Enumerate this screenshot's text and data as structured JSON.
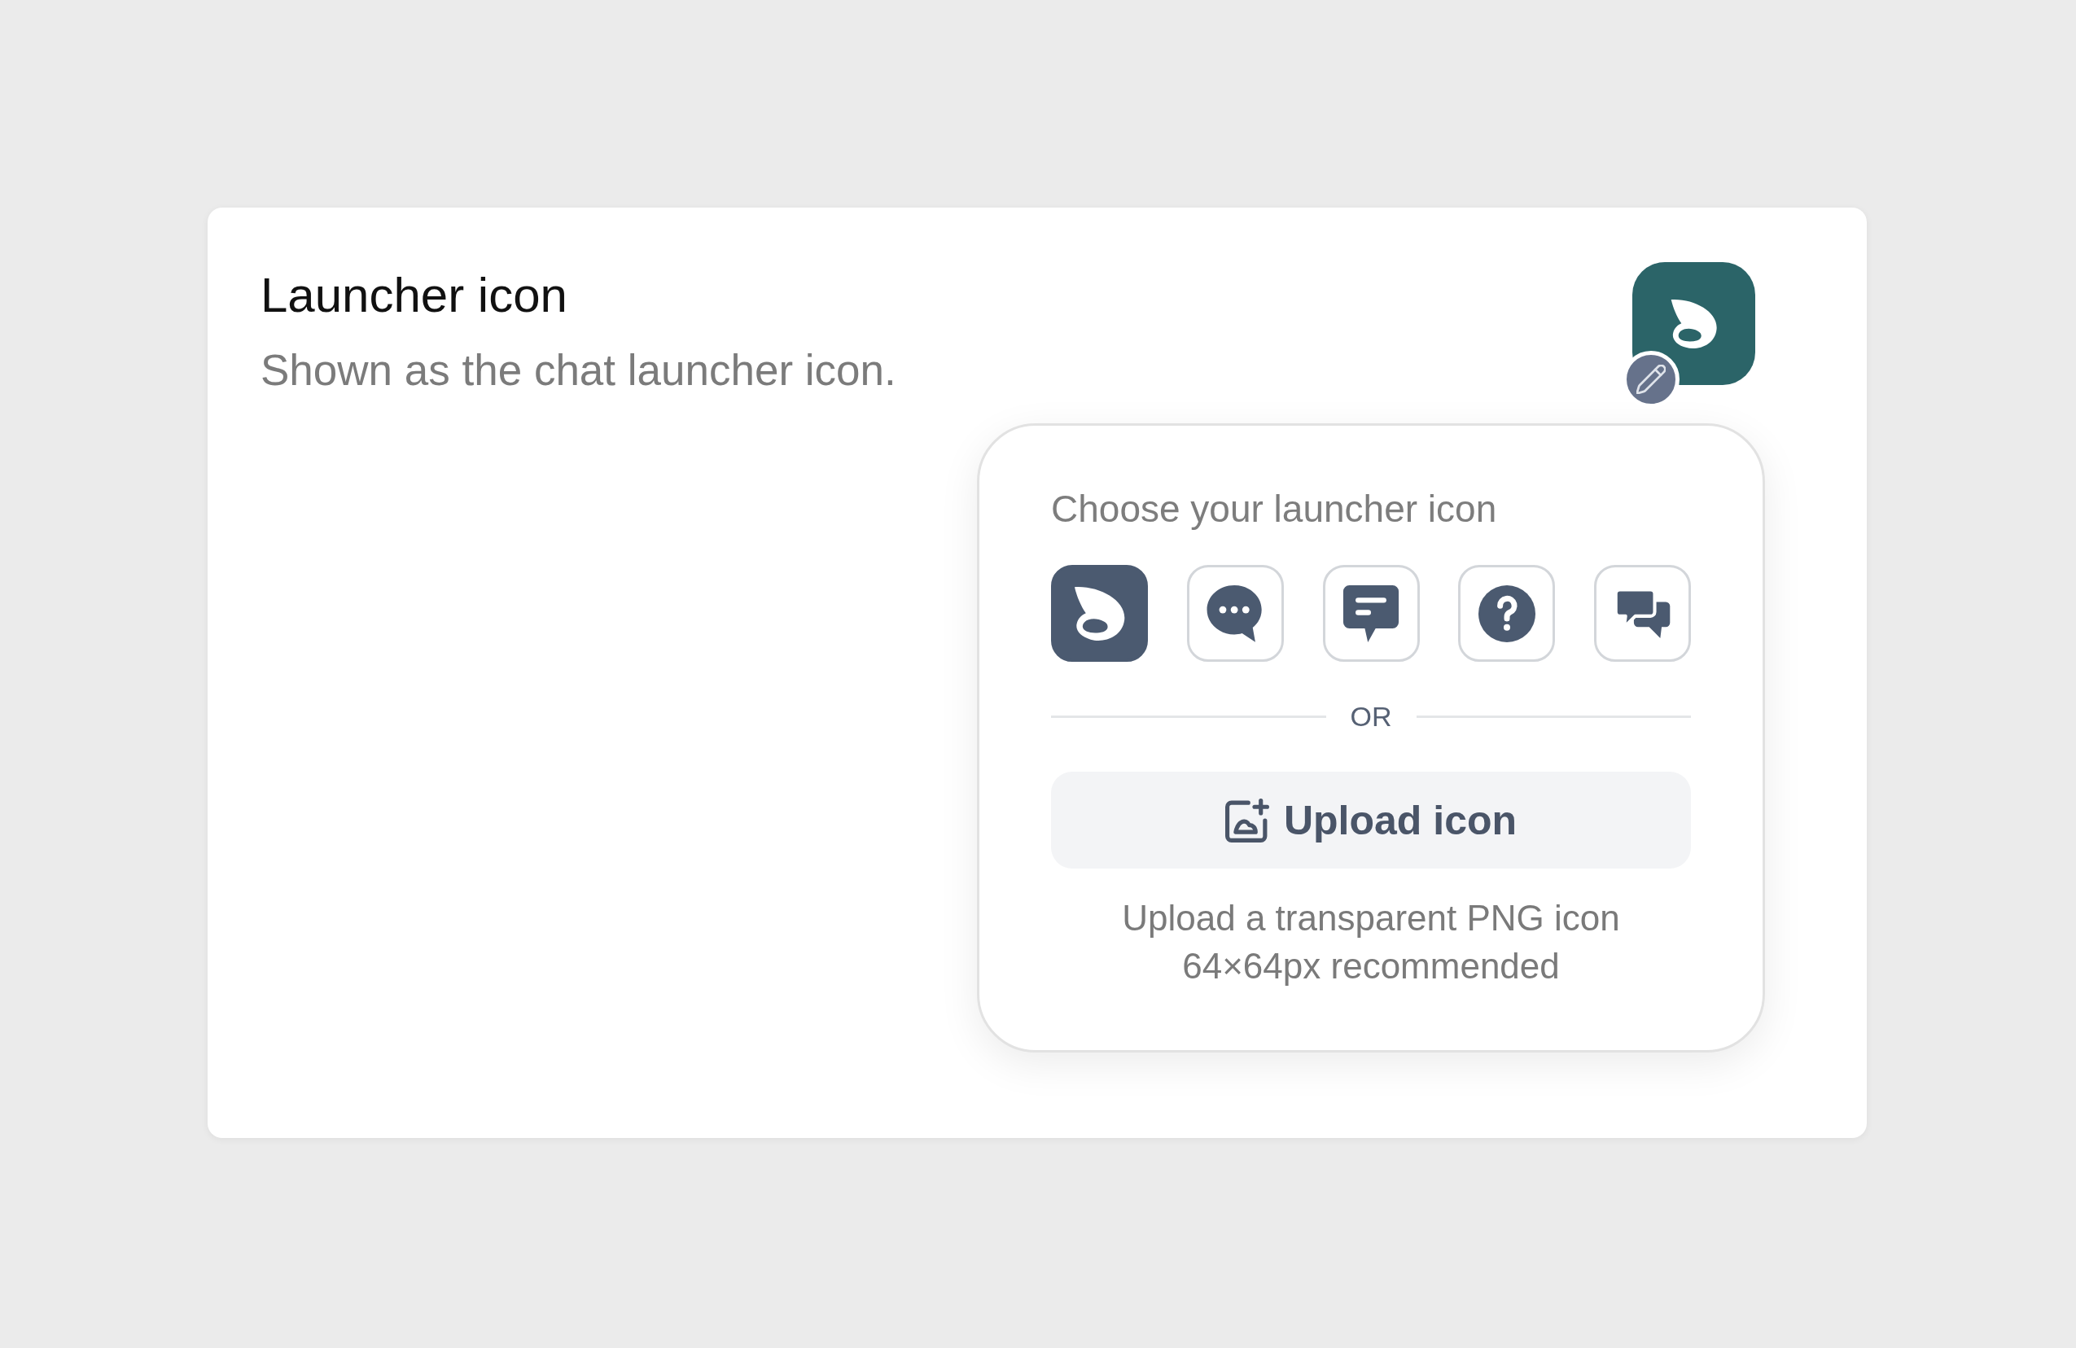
{
  "settings_card": {
    "title": "Launcher icon",
    "description": "Shown as the chat launcher icon."
  },
  "picker": {
    "heading": "Choose your launcher icon",
    "options": [
      {
        "kind": "swirl",
        "selected": true
      },
      {
        "kind": "chat-dots",
        "selected": false
      },
      {
        "kind": "chat-lines",
        "selected": false
      },
      {
        "kind": "help",
        "selected": false
      },
      {
        "kind": "chats",
        "selected": false
      }
    ],
    "divider_label": "OR",
    "upload_button": "Upload icon",
    "hint_lines": [
      "Upload a transparent PNG icon",
      "64×64px recommended"
    ]
  }
}
